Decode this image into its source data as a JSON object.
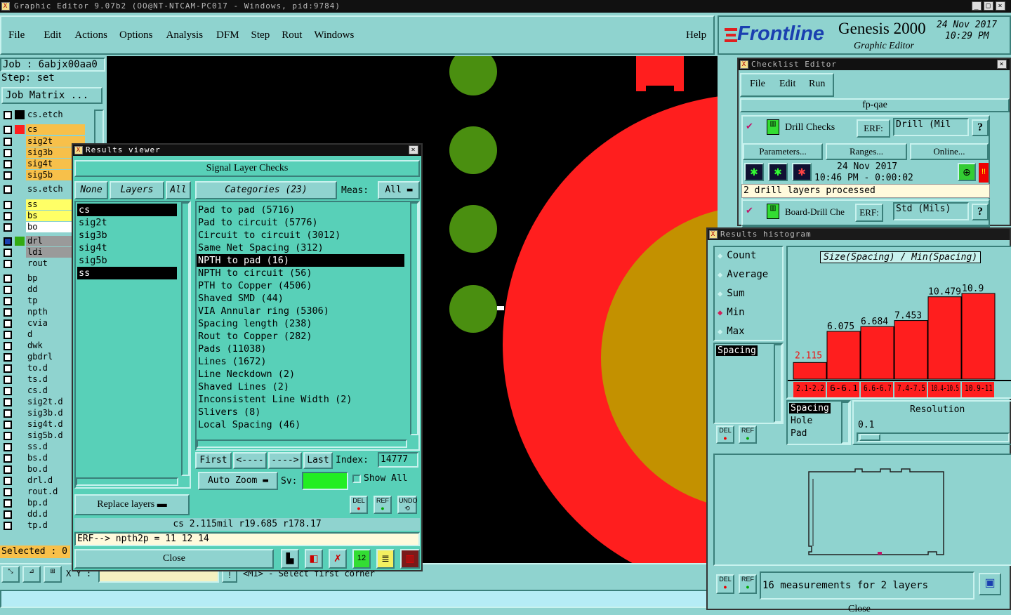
{
  "window": {
    "title": "Graphic Editor 9.07b2 (OO@NT-NTCAM-PC017 - Windows, pid:9784)"
  },
  "menu": {
    "items": [
      "File",
      "Edit",
      "Actions",
      "Options",
      "Analysis",
      "DFM",
      "Step",
      "Rout",
      "Windows"
    ],
    "help": "Help"
  },
  "brand": {
    "logo": "Frontline",
    "product": "Genesis 2000",
    "subtitle": "Graphic Editor",
    "date": "24 Nov 2017",
    "time": "10:29 PM"
  },
  "job": {
    "job_label": "Job : 6abjx00aa0",
    "step_label": "Step: set",
    "matrix_button": "Job Matrix ..."
  },
  "layers": [
    {
      "name": "cs.etch",
      "color": "#000000",
      "bg": "#8fd3cf"
    },
    {
      "name": "cs",
      "color": "#ff1e1e",
      "bg": "#f7c04a"
    },
    {
      "name": "sig2t",
      "color": "",
      "bg": "#f7c04a"
    },
    {
      "name": "sig3b",
      "color": "",
      "bg": "#f7c04a"
    },
    {
      "name": "sig4t",
      "color": "",
      "bg": "#f7c04a"
    },
    {
      "name": "sig5b",
      "color": "",
      "bg": "#f7c04a"
    },
    {
      "name": "ss.etch",
      "color": "",
      "bg": "#8fd3cf"
    },
    {
      "name": "ss",
      "color": "",
      "bg": "#ffff66"
    },
    {
      "name": "bs",
      "color": "",
      "bg": "#ffff66"
    },
    {
      "name": "bo",
      "color": "",
      "bg": "#ffffff"
    },
    {
      "name": "drl",
      "color": "#33aa11",
      "bg": "#9a9a9a"
    },
    {
      "name": "ldi",
      "color": "",
      "bg": "#9a9a9a"
    },
    {
      "name": "rout",
      "color": "",
      "bg": "#8fd3cf"
    },
    {
      "name": "bp",
      "color": "",
      "bg": "#8fd3cf"
    },
    {
      "name": "dd",
      "color": "",
      "bg": "#8fd3cf"
    },
    {
      "name": "tp",
      "color": "",
      "bg": "#8fd3cf"
    },
    {
      "name": "npth",
      "color": "",
      "bg": "#8fd3cf"
    },
    {
      "name": "cvia",
      "color": "",
      "bg": "#8fd3cf"
    },
    {
      "name": "d",
      "color": "",
      "bg": "#8fd3cf"
    },
    {
      "name": "dwk",
      "color": "",
      "bg": "#8fd3cf"
    },
    {
      "name": "gbdrl",
      "color": "",
      "bg": "#8fd3cf"
    },
    {
      "name": "to.d",
      "color": "",
      "bg": "#8fd3cf"
    },
    {
      "name": "ts.d",
      "color": "",
      "bg": "#8fd3cf"
    },
    {
      "name": "cs.d",
      "color": "",
      "bg": "#8fd3cf"
    },
    {
      "name": "sig2t.d",
      "color": "",
      "bg": "#8fd3cf"
    },
    {
      "name": "sig3b.d",
      "color": "",
      "bg": "#8fd3cf"
    },
    {
      "name": "sig4t.d",
      "color": "",
      "bg": "#8fd3cf"
    },
    {
      "name": "sig5b.d",
      "color": "",
      "bg": "#8fd3cf"
    },
    {
      "name": "ss.d",
      "color": "",
      "bg": "#8fd3cf"
    },
    {
      "name": "bs.d",
      "color": "",
      "bg": "#8fd3cf"
    },
    {
      "name": "bo.d",
      "color": "",
      "bg": "#8fd3cf"
    },
    {
      "name": "drl.d",
      "color": "",
      "bg": "#8fd3cf"
    },
    {
      "name": "rout.d",
      "color": "",
      "bg": "#8fd3cf"
    },
    {
      "name": "bp.d",
      "color": "",
      "bg": "#8fd3cf"
    },
    {
      "name": "dd.d",
      "color": "",
      "bg": "#8fd3cf"
    },
    {
      "name": "tp.d",
      "color": "",
      "bg": "#8fd3cf"
    }
  ],
  "selected_label": "Selected : 0",
  "status": {
    "coord_label": "X Y :",
    "prompt": "<M1> - Select first corner"
  },
  "results_viewer": {
    "title": "Results viewer",
    "header": "Signal Layer Checks",
    "none_btn": "None",
    "layers_btn": "Layers",
    "all_btn": "All",
    "layer_list": [
      "cs",
      "sig2t",
      "sig3b",
      "sig4t",
      "sig5b",
      "ss"
    ],
    "categories_label": "Categories (23)",
    "meas_label": "Meas:",
    "meas_value": "All",
    "categories": [
      "Pad to pad (5716)",
      "Pad to circuit (5776)",
      "Circuit to circuit (3012)",
      "Same Net Spacing (312)",
      "NPTH to pad (16)",
      "NPTH to circuit (56)",
      "PTH to Copper (4506)",
      "Shaved SMD (44)",
      "VIA Annular ring (5306)",
      "Spacing length (238)",
      "Rout to Copper (282)",
      "Pads (11038)",
      "Lines (1672)",
      "Line Neckdown (2)",
      "Shaved Lines (2)",
      "Inconsistent Line Width (2)",
      "Slivers (8)",
      "Local Spacing (46)"
    ],
    "nav": {
      "first": "First",
      "prev": "<----",
      "next": "---->",
      "last": "Last",
      "index_label": "Index:",
      "index_value": "14777"
    },
    "auto_zoom": "Auto Zoom",
    "sv_label": "Sv:",
    "show_all": "Show All",
    "replace_layers": "Replace layers",
    "del": "DEL",
    "ref": "REF",
    "undo": "UNDO",
    "measure_line": "cs 2.115mil   r19.685  r178.17",
    "erf_line": "ERF--> npth2p = 11 12 14",
    "close": "Close"
  },
  "checklist": {
    "title": "Checklist Editor",
    "menu": [
      "File",
      "Edit",
      "Run"
    ],
    "name": "fp-qae",
    "drill_checks": "Drill Checks",
    "erf_label": "ERF:",
    "erf_value": "Drill (Mil",
    "parameters": "Parameters...",
    "ranges": "Ranges...",
    "online": "Online...",
    "run_date": "24 Nov 2017",
    "run_time": "10:46 PM - 0:00:02",
    "status_msg": "2 drill layers processed",
    "board_drill": "Board-Drill Che",
    "erf_value2": "Std (Mils)",
    "help": "?"
  },
  "histogram": {
    "title": "Results histogram",
    "modes": [
      "Count",
      "Average",
      "Sum",
      "Min",
      "Max"
    ],
    "selected_mode": "Min",
    "measure_list": [
      "Spacing"
    ],
    "chart_title": "Size(Spacing) / Min(Spacing)",
    "attr_list": [
      "Spacing",
      "Hole",
      "Pad"
    ],
    "resolution_label": "Resolution",
    "resolution_value": "0.1",
    "summary": "16 measurements for 2 layers",
    "close": "Close"
  },
  "chart_data": {
    "type": "bar",
    "title": "Size(Spacing) / Min(Spacing)",
    "categories": [
      "2.1-2.2",
      "6-6.1",
      "6.6-6.7",
      "7.4-7.5",
      "10.4-10.5",
      "10.9-11"
    ],
    "values": [
      2.115,
      6.075,
      6.684,
      7.453,
      10.479,
      10.9
    ],
    "value_labels": [
      "2.115",
      "6.075",
      "6.684",
      "7.453",
      "10.479",
      "10.9"
    ],
    "ylim": [
      0,
      10.9
    ],
    "bar_color": "#ff1e1e",
    "grid": false
  }
}
